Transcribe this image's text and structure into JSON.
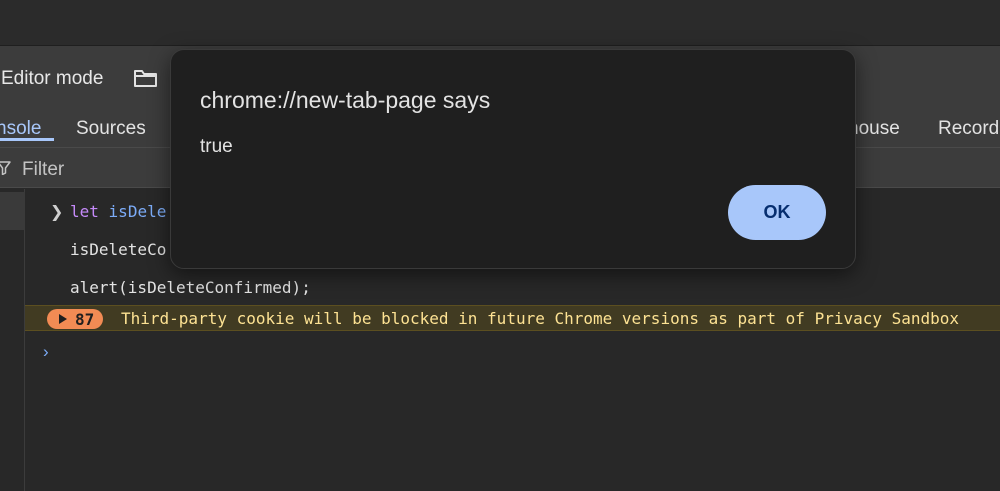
{
  "toolbar": {
    "editor_mode_label": "Editor mode",
    "folder_icon": "folder-icon"
  },
  "tabs": [
    {
      "label": "nsole",
      "active": true
    },
    {
      "label": "Sources",
      "active": false
    },
    {
      "label": "house",
      "active": false
    },
    {
      "label": "Record",
      "active": false
    }
  ],
  "filter": {
    "icon": "filter-icon",
    "placeholder": "Filter"
  },
  "console": {
    "input_line": {
      "keyword": "let",
      "text": "isDele"
    },
    "lines": [
      "isDeleteCo",
      "alert(isDeleteConfirmed);"
    ],
    "warning": {
      "count": "87",
      "text": "Third-party cookie will be blocked in future Chrome versions as part of Privacy Sandbox"
    }
  },
  "dialog": {
    "title": "chrome://new-tab-page says",
    "message": "true",
    "ok_label": "OK"
  },
  "colors": {
    "accent": "#a8c7fa",
    "warning_badge": "#f28b54",
    "warning_text": "#fde293",
    "dialog_bg": "#1f1f1f"
  }
}
